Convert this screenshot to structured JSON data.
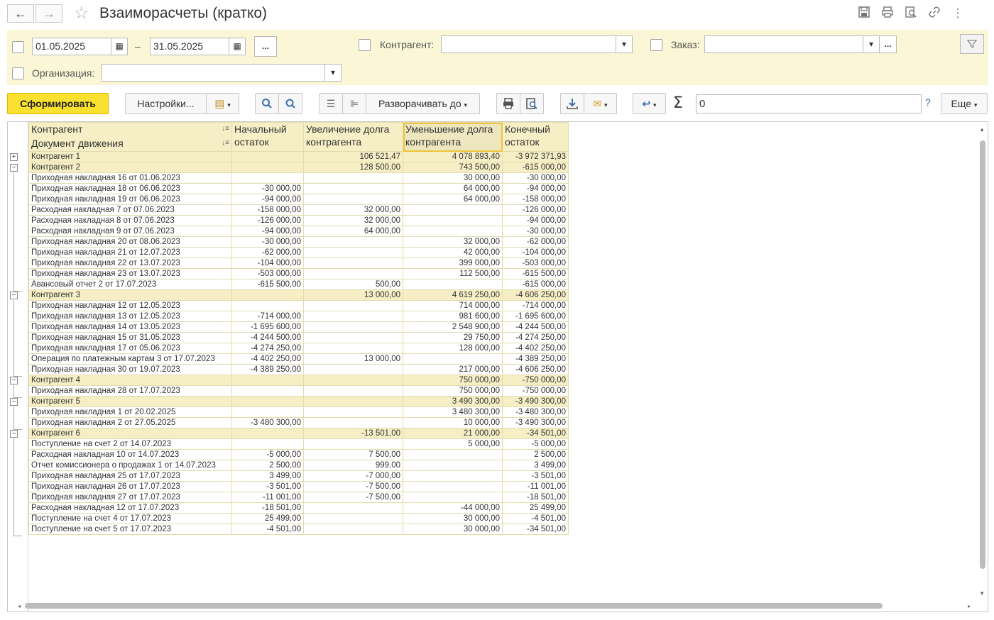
{
  "window": {
    "title": "Взаиморасчеты (кратко)",
    "back_icon": "←",
    "forward_icon": "→"
  },
  "filters": {
    "date_from": "01.05.2025",
    "date_separator": "–",
    "date_to": "31.05.2025",
    "period_button": "...",
    "counterparty_label": "Контрагент:",
    "counterparty_value": "",
    "order_label": "Заказ:",
    "order_value": "",
    "order_more": "...",
    "organization_label": "Организация:",
    "organization_value": ""
  },
  "toolbar": {
    "generate_label": "Сформировать",
    "settings_label": "Настройки...",
    "expand_label": "Разворачивать до",
    "sum_value": "0",
    "help_label": "?",
    "more_label": "Еще",
    "sigma": "Σ"
  },
  "table": {
    "headers": {
      "col1_line1": "Контрагент",
      "col1_line2": "Документ движения",
      "col2": "Начальный остаток",
      "col3": "Увеличение долга контрагента",
      "col4": "Уменьшение долга контрагента",
      "col5": "Конечный остаток"
    },
    "rows": [
      {
        "type": "group",
        "toggle": "+",
        "name": "Контрагент 1",
        "start": "",
        "inc": "106 521,47",
        "dec": "4 078 893,40",
        "end": "-3 972 371,93"
      },
      {
        "type": "group",
        "toggle": "−",
        "name": "Контрагент 2",
        "start": "",
        "inc": "128 500,00",
        "dec": "743 500,00",
        "end": "-615 000,00"
      },
      {
        "type": "doc",
        "name": "Приходная накладная 16 от 01.06.2023",
        "start": "",
        "inc": "",
        "dec": "30 000,00",
        "end": "-30 000,00"
      },
      {
        "type": "doc",
        "name": "Приходная накладная 18 от 06.06.2023",
        "start": "-30 000,00",
        "inc": "",
        "dec": "64 000,00",
        "end": "-94 000,00"
      },
      {
        "type": "doc",
        "name": "Приходная накладная 19 от 06.06.2023",
        "start": "-94 000,00",
        "inc": "",
        "dec": "64 000,00",
        "end": "-158 000,00"
      },
      {
        "type": "doc",
        "name": "Расходная накладная 7 от 07.06.2023",
        "start": "-158 000,00",
        "inc": "32 000,00",
        "dec": "",
        "end": "-126 000,00"
      },
      {
        "type": "doc",
        "name": "Расходная накладная 8 от 07.06.2023",
        "start": "-126 000,00",
        "inc": "32 000,00",
        "dec": "",
        "end": "-94 000,00"
      },
      {
        "type": "doc",
        "name": "Расходная накладная 9 от 07.06.2023",
        "start": "-94 000,00",
        "inc": "64 000,00",
        "dec": "",
        "end": "-30 000,00"
      },
      {
        "type": "doc",
        "name": "Приходная накладная 20 от 08.06.2023",
        "start": "-30 000,00",
        "inc": "",
        "dec": "32 000,00",
        "end": "-62 000,00"
      },
      {
        "type": "doc",
        "name": "Приходная накладная 21 от 12.07.2023",
        "start": "-62 000,00",
        "inc": "",
        "dec": "42 000,00",
        "end": "-104 000,00"
      },
      {
        "type": "doc",
        "name": "Приходная накладная 22 от 13.07.2023",
        "start": "-104 000,00",
        "inc": "",
        "dec": "399 000,00",
        "end": "-503 000,00"
      },
      {
        "type": "doc",
        "name": "Приходная накладная 23 от 13.07.2023",
        "start": "-503 000,00",
        "inc": "",
        "dec": "112 500,00",
        "end": "-615 500,00"
      },
      {
        "type": "doc",
        "name": "Авансовый отчет 2 от 17.07.2023",
        "start": "-615 500,00",
        "inc": "500,00",
        "dec": "",
        "end": "-615 000,00"
      },
      {
        "type": "group",
        "toggle": "−",
        "name": "Контрагент 3",
        "start": "",
        "inc": "13 000,00",
        "dec": "4 619 250,00",
        "end": "-4 606 250,00"
      },
      {
        "type": "doc",
        "name": "Приходная накладная 12 от 12.05.2023",
        "start": "",
        "inc": "",
        "dec": "714 000,00",
        "end": "-714 000,00"
      },
      {
        "type": "doc",
        "name": "Приходная накладная 13 от 12.05.2023",
        "start": "-714 000,00",
        "inc": "",
        "dec": "981 600,00",
        "end": "-1 695 600,00"
      },
      {
        "type": "doc",
        "name": "Приходная накладная 14 от 13.05.2023",
        "start": "-1 695 600,00",
        "inc": "",
        "dec": "2 548 900,00",
        "end": "-4 244 500,00"
      },
      {
        "type": "doc",
        "name": "Приходная накладная 15 от 31.05.2023",
        "start": "-4 244 500,00",
        "inc": "",
        "dec": "29 750,00",
        "end": "-4 274 250,00"
      },
      {
        "type": "doc",
        "name": "Приходная накладная 17 от 05.06.2023",
        "start": "-4 274 250,00",
        "inc": "",
        "dec": "128 000,00",
        "end": "-4 402 250,00"
      },
      {
        "type": "doc",
        "name": "Операция по платежным картам 3 от 17.07.2023",
        "start": "-4 402 250,00",
        "inc": "13 000,00",
        "dec": "",
        "end": "-4 389 250,00"
      },
      {
        "type": "doc",
        "name": "Приходная накладная 30 от 19.07.2023",
        "start": "-4 389 250,00",
        "inc": "",
        "dec": "217 000,00",
        "end": "-4 606 250,00"
      },
      {
        "type": "group",
        "toggle": "−",
        "name": "Контрагент 4",
        "start": "",
        "inc": "",
        "dec": "750 000,00",
        "end": "-750 000,00"
      },
      {
        "type": "doc",
        "name": "Приходная накладная 28 от 17.07.2023",
        "start": "",
        "inc": "",
        "dec": "750 000,00",
        "end": "-750 000,00"
      },
      {
        "type": "group",
        "toggle": "−",
        "name": "Контрагент 5",
        "start": "",
        "inc": "",
        "dec": "3 490 300,00",
        "end": "-3 490 300,00"
      },
      {
        "type": "doc",
        "name": "Приходная накладная 1 от 20.02.2025",
        "start": "",
        "inc": "",
        "dec": "3 480 300,00",
        "end": "-3 480 300,00"
      },
      {
        "type": "doc",
        "name": "Приходная накладная 2 от 27.05.2025",
        "start": "-3 480 300,00",
        "inc": "",
        "dec": "10 000,00",
        "end": "-3 490 300,00"
      },
      {
        "type": "group",
        "toggle": "−",
        "name": "Контрагент 6",
        "start": "",
        "inc": "-13 501,00",
        "dec": "21 000,00",
        "end": "-34 501,00"
      },
      {
        "type": "doc",
        "name": "Поступление на счет 2 от 14.07.2023",
        "start": "",
        "inc": "",
        "dec": "5 000,00",
        "end": "-5 000,00"
      },
      {
        "type": "doc",
        "name": "Расходная накладная 10 от 14.07.2023",
        "start": "-5 000,00",
        "inc": "7 500,00",
        "dec": "",
        "end": "2 500,00"
      },
      {
        "type": "doc",
        "name": "Отчет комиссионера о продажах 1 от 14.07.2023",
        "start": "2 500,00",
        "inc": "999,00",
        "dec": "",
        "end": "3 499,00"
      },
      {
        "type": "doc",
        "name": "Приходная накладная 25 от 17.07.2023",
        "start": "3 499,00",
        "inc": "-7 000,00",
        "dec": "",
        "end": "-3 501,00"
      },
      {
        "type": "doc",
        "name": "Приходная накладная 26 от 17.07.2023",
        "start": "-3 501,00",
        "inc": "-7 500,00",
        "dec": "",
        "end": "-11 001,00"
      },
      {
        "type": "doc",
        "name": "Приходная накладная 27 от 17.07.2023",
        "start": "-11 001,00",
        "inc": "-7 500,00",
        "dec": "",
        "end": "-18 501,00"
      },
      {
        "type": "doc",
        "name": "Расходная накладная 12 от 17.07.2023",
        "start": "-18 501,00",
        "inc": "",
        "dec": "-44 000,00",
        "end": "25 499,00"
      },
      {
        "type": "doc",
        "name": "Поступление на счет 4 от 17.07.2023",
        "start": "25 499,00",
        "inc": "",
        "dec": "30 000,00",
        "end": "-4 501,00"
      },
      {
        "type": "doc",
        "name": "Поступление на счет 5 от 17.07.2023",
        "start": "-4 501,00",
        "inc": "",
        "dec": "30 000,00",
        "end": "-34 501,00"
      }
    ]
  }
}
